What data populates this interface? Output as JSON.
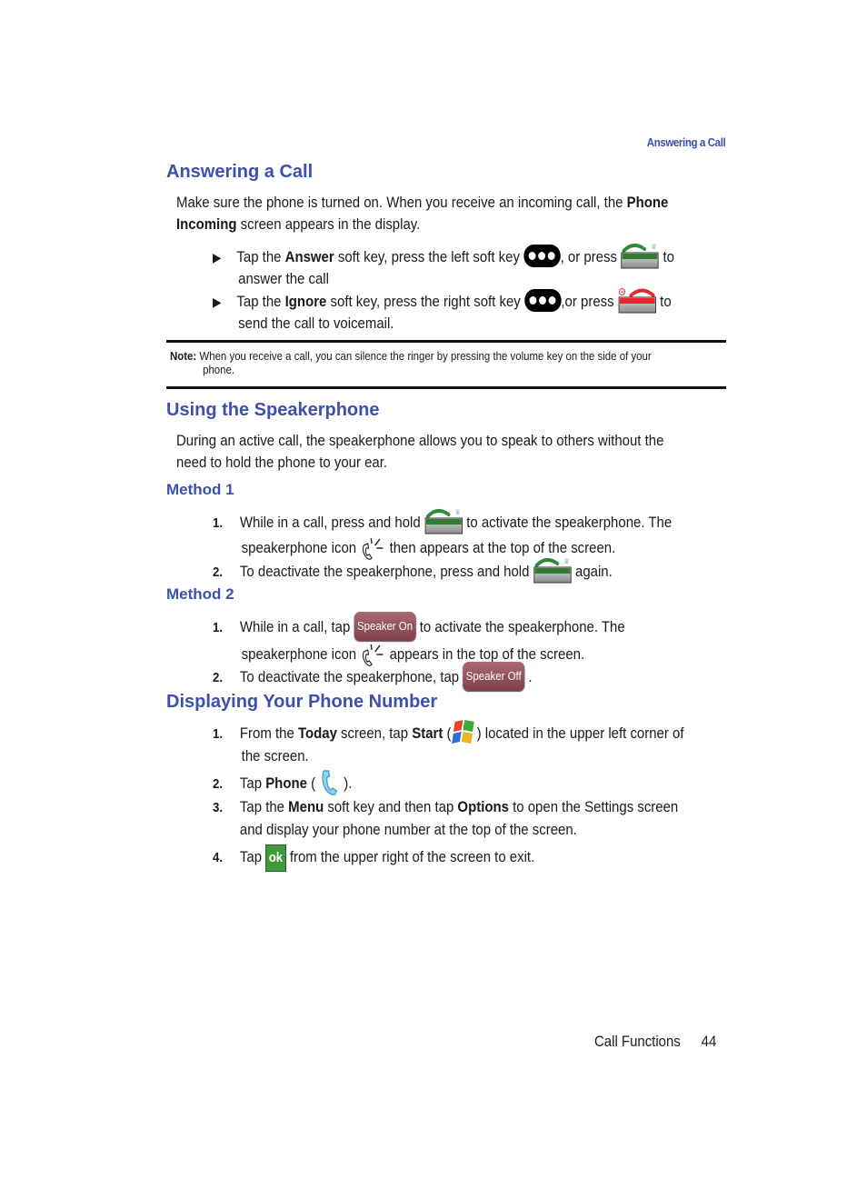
{
  "running_head": "Answering a Call",
  "sections": {
    "answering": {
      "title": "Answering a Call",
      "intro_pre": "Make sure the phone is turned on. When you receive an incoming call, the ",
      "intro_bold": "Phone Incoming",
      "intro_post": " screen appears in the display.",
      "bullets": [
        {
          "pre": "Tap the ",
          "bold": "Answer",
          "mid": " soft key, press the left soft key ",
          "mid2": ", or press ",
          "post": " to",
          "cont": "answer the call",
          "key_icon": "left-soft-key-icon",
          "press_icon": "send-key-icon"
        },
        {
          "pre": "Tap the ",
          "bold": "Ignore",
          "mid": " soft key, press the right soft key ",
          "mid2": ",or press ",
          "post": " to",
          "cont": "send the call to voicemail.",
          "key_icon": "right-soft-key-icon",
          "press_icon": "end-key-icon"
        }
      ]
    },
    "note": {
      "label": "Note:",
      "text1": " When you receive a call, you can silence the ringer by pressing the volume key on the side of your",
      "text2": "phone."
    },
    "speakerphone": {
      "title": "Using the Speakerphone",
      "intro_line1": "During an active call, the speakerphone allows you to speak to others without the",
      "intro_line2": "need to hold the phone to your ear.",
      "method1": {
        "title": "Method 1",
        "steps": [
          {
            "num": "1.",
            "pre": "While in a call, press and hold ",
            "post": " to activate the speakerphone. The",
            "cont_pre": "speakerphone icon ",
            "cont_post": " then appears at the top of the screen."
          },
          {
            "num": "2.",
            "pre": "To deactivate the speakerphone, press and hold ",
            "post": " again."
          }
        ]
      },
      "method2": {
        "title": "Method 2",
        "steps": [
          {
            "num": "1.",
            "pre": "While in a call, tap ",
            "button": "Speaker On",
            "post": " to activate the speakerphone. The",
            "cont_pre": "speakerphone icon ",
            "cont_post": " appears in the top of the screen."
          },
          {
            "num": "2.",
            "pre": "To deactivate the speakerphone, tap ",
            "button": "Speaker Off",
            "post": "."
          }
        ]
      }
    },
    "phone_number": {
      "title": "Displaying Your Phone Number",
      "steps": [
        {
          "num": "1.",
          "pre": "From the ",
          "b1": "Today",
          "mid": " screen, tap ",
          "b2": "Start",
          "paren_open": " (",
          "paren_close": ") located in the upper left corner of",
          "cont": "the screen."
        },
        {
          "num": "2.",
          "pre": "Tap ",
          "b1": "Phone",
          "paren_open": " ( ",
          "paren_close": " )."
        },
        {
          "num": "3.",
          "pre": "Tap the ",
          "b1": "Menu",
          "mid": " soft key and then tap ",
          "b2": "Options",
          "post": " to open the Settings screen",
          "cont": "and display your phone number at the top of the screen."
        },
        {
          "num": "4.",
          "pre": "Tap ",
          "button": "ok",
          "post": " from the upper right of the screen to exit."
        }
      ]
    }
  },
  "footer": {
    "chapter": "Call Functions",
    "page": "44"
  },
  "colors": {
    "heading": "#3c50ad",
    "send_key": "#2e7d32",
    "end_key": "#e8262c",
    "speaker_button": "#8a4d56",
    "ok_button": "#3f9a3b"
  }
}
